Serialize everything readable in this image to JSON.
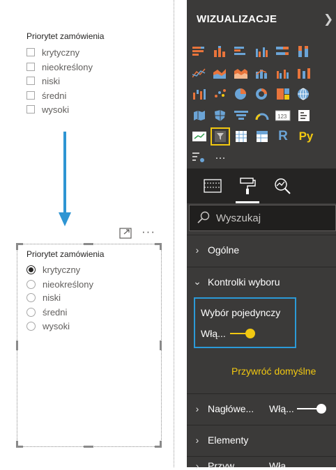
{
  "slicer": {
    "title": "Priorytet zamówienia",
    "options": [
      "krytyczny",
      "nieokreślony",
      "niski",
      "średni",
      "wysoki"
    ],
    "selected": "krytyczny"
  },
  "pane": {
    "title": "WIZUALIZACJE",
    "search_placeholder": "Wyszukaj",
    "sections": {
      "general": "Ogólne",
      "selection_controls": "Kontrolki wyboru",
      "single_select_label": "Wybór pojedynczy",
      "single_select_toggle": "Włą...",
      "reset": "Przywróć domyślne",
      "header": "Nagłówe...",
      "header_toggle": "Włą...",
      "items": "Elementy",
      "partial_label": "Przyw...",
      "partial_toggle": "Wła..."
    },
    "more_visuals": "···",
    "r_label": "R",
    "py_label": "Py",
    "accent_color": "#f2c811",
    "highlight_color": "#2b9ad8"
  },
  "visual_header": {
    "more_label": "···"
  }
}
